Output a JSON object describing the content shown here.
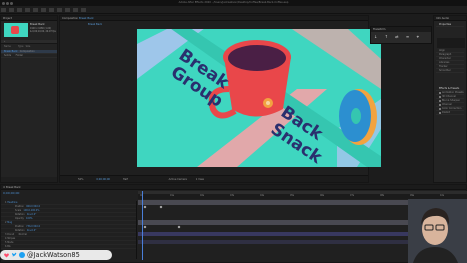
{
  "window": {
    "title": "Adobe After Effects 2020 - /Users/jackwatson/Desktop/Coffee/Break-Back-Coffee.aep"
  },
  "project_panel": {
    "tab_label": "Project",
    "comp_name": "Break Back",
    "comp_info": "1920 x 1080 (1.00)",
    "comp_info2": "Δ 0;00;10;00, 29.97 fps",
    "columns": [
      "Name",
      "Type",
      "Size"
    ],
    "items": [
      {
        "name": "Break Back",
        "type": "Composition"
      },
      {
        "name": "Solids",
        "type": "Folder"
      }
    ]
  },
  "composition_panel": {
    "tab_label": "Composition",
    "comp_tab": "Break Back",
    "zoom": "50%",
    "timecode": "0;00;00;00",
    "resolution": "Half",
    "camera": "Active Camera",
    "view": "1 View"
  },
  "artwork": {
    "headline_lines": [
      "Break",
      "Back",
      "Group",
      "Snack"
    ],
    "bg_color": "#3fd6c0",
    "stripe_pink": "#f3a3a7",
    "stripe_blue": "#a9c4ee",
    "mug_color": "#e9474a",
    "coffee_color": "#4a1f45",
    "text_color": "#2a2f6e",
    "donut_color": "#2c8fd0"
  },
  "toolbox_popup": {
    "title": "Transform",
    "buttons": [
      "↓",
      "↑",
      "⇄",
      "≡",
      "⌖"
    ]
  },
  "right_panels": {
    "tabs": [
      "Info",
      "Audio",
      "Preview"
    ],
    "section": "Properties",
    "fields": [
      "Align",
      "Paragraph",
      "Character",
      "Libraries",
      "Tracker",
      "Smoother"
    ],
    "effects_label": "Effects & Presets",
    "effects": [
      "Animation Presets",
      "3D Channel",
      "Blur & Sharpen",
      "Channel",
      "Color Correction",
      "Distort"
    ]
  },
  "timeline_panel": {
    "tab_label": "Break Back",
    "timecode": "0;00;00;00",
    "layers": [
      {
        "num": "1",
        "name": "Headline"
      },
      {
        "num": "",
        "name": "Position",
        "value": "960.0,540.0"
      },
      {
        "num": "",
        "name": "Scale",
        "value": "100.0,100.0%"
      },
      {
        "num": "",
        "name": "Rotation",
        "value": "0x+0.0°"
      },
      {
        "num": "",
        "name": "Opacity",
        "value": "100%"
      },
      {
        "num": "2",
        "name": "Mug"
      },
      {
        "num": "",
        "name": "Position",
        "value": "736.0,540.0"
      },
      {
        "num": "",
        "name": "Rotation",
        "value": "0x+0.0°"
      },
      {
        "num": "3",
        "name": "Donut"
      },
      {
        "num": "4",
        "name": "Stripes"
      },
      {
        "num": "5",
        "name": "Mode"
      },
      {
        "num": "6",
        "name": "BG"
      }
    ],
    "ruler_labels": [
      "0s",
      "01s",
      "02s",
      "03s",
      "04s",
      "05s",
      "06s",
      "07s",
      "08s",
      "09s",
      "10s"
    ],
    "mode_label": "Normal"
  },
  "social": {
    "handle": "@JackWatson85"
  }
}
